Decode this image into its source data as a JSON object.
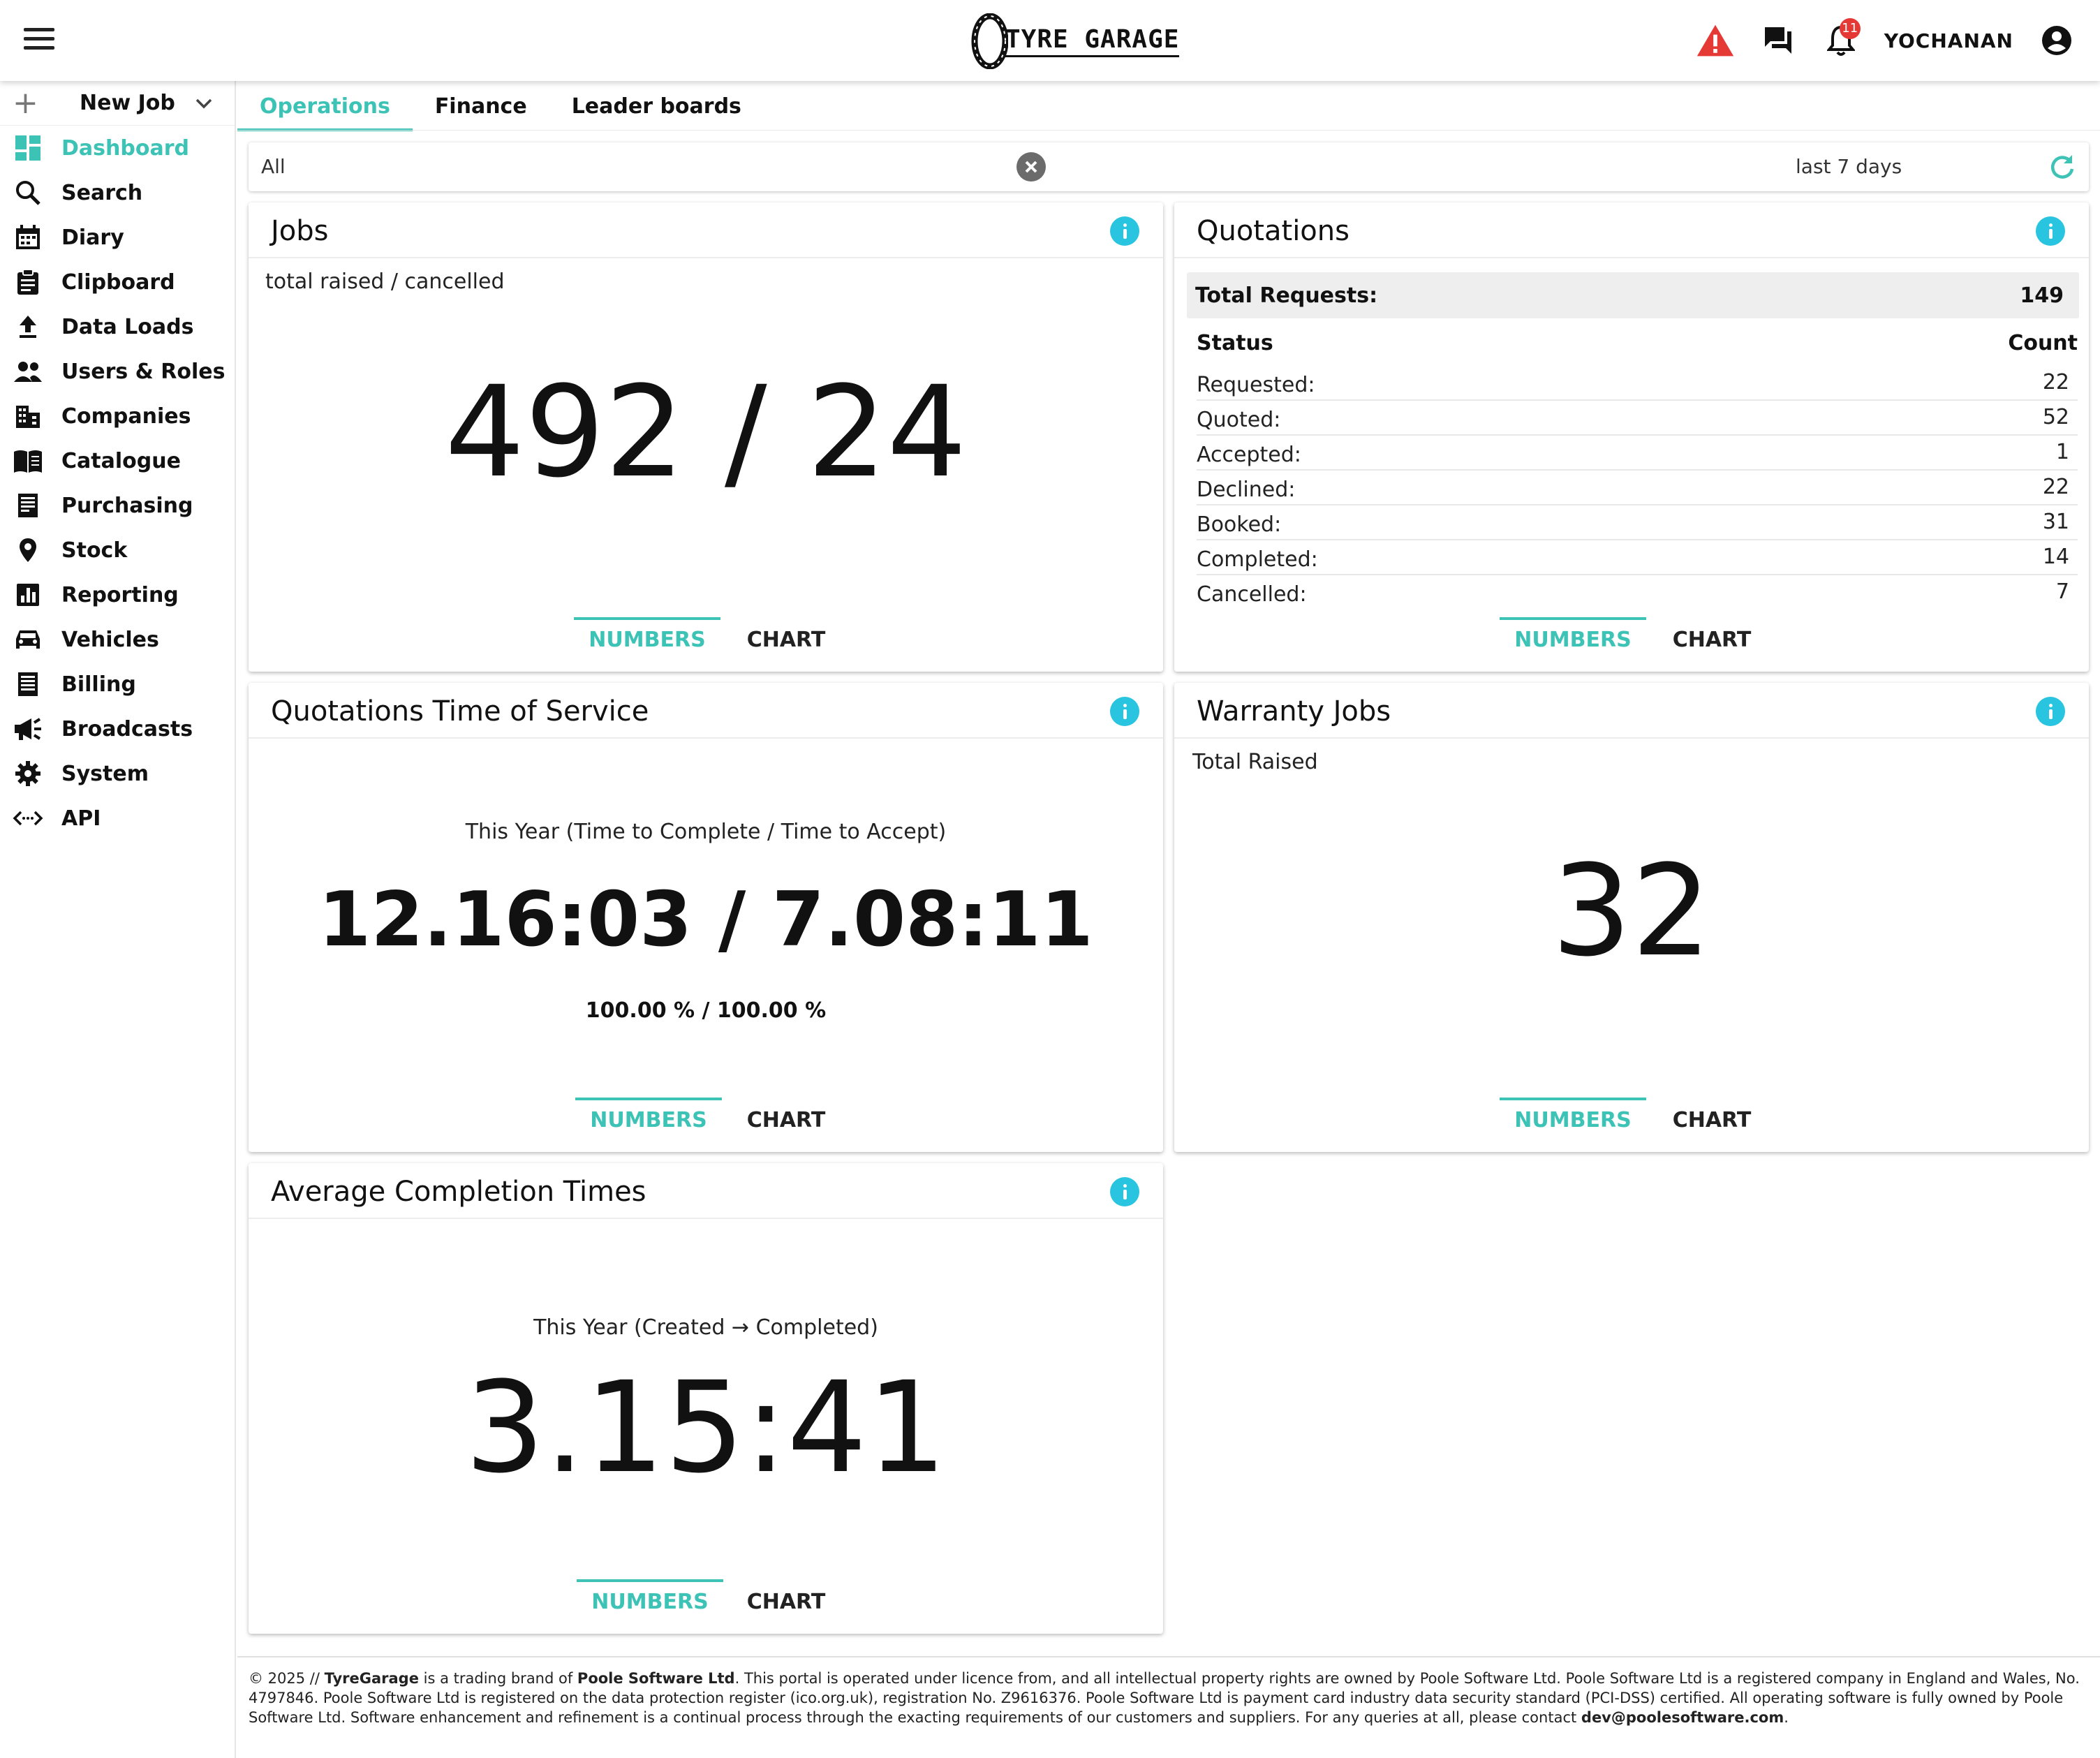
{
  "header": {
    "logo_text": "TYRE GARAGE",
    "username": "YOCHANAN",
    "notification_count": "11",
    "accent": "#3cc3b5",
    "alert_color": "#e53935"
  },
  "sidebar": {
    "new_job_label": "New Job",
    "items": [
      {
        "label": "Dashboard",
        "icon": "dashboard-icon",
        "active": true
      },
      {
        "label": "Search",
        "icon": "search-icon"
      },
      {
        "label": "Diary",
        "icon": "calendar-icon"
      },
      {
        "label": "Clipboard",
        "icon": "clipboard-icon"
      },
      {
        "label": "Data Loads",
        "icon": "upload-icon"
      },
      {
        "label": "Users & Roles",
        "icon": "people-icon"
      },
      {
        "label": "Companies",
        "icon": "building-icon"
      },
      {
        "label": "Catalogue",
        "icon": "book-icon"
      },
      {
        "label": "Purchasing",
        "icon": "receipt-icon"
      },
      {
        "label": "Stock",
        "icon": "location-pin-icon"
      },
      {
        "label": "Reporting",
        "icon": "bar-chart-icon"
      },
      {
        "label": "Vehicles",
        "icon": "car-icon"
      },
      {
        "label": "Billing",
        "icon": "invoice-icon"
      },
      {
        "label": "Broadcasts",
        "icon": "megaphone-icon"
      },
      {
        "label": "System",
        "icon": "gear-icon"
      },
      {
        "label": "API",
        "icon": "code-icon"
      }
    ]
  },
  "tabs": [
    {
      "label": "Operations",
      "active": true
    },
    {
      "label": "Finance"
    },
    {
      "label": "Leader boards"
    }
  ],
  "filter": {
    "value": "All",
    "period": "last 7 days"
  },
  "toggle": {
    "numbers": "NUMBERS",
    "chart": "CHART"
  },
  "cards": {
    "jobs": {
      "title": "Jobs",
      "subtitle": "total raised / cancelled",
      "value": "492 / 24"
    },
    "quotations": {
      "title": "Quotations",
      "total_label": "Total Requests:",
      "total_value": "149",
      "status_header": "Status",
      "count_header": "Count",
      "rows": [
        {
          "status": "Requested:",
          "count": "22"
        },
        {
          "status": "Quoted:",
          "count": "52"
        },
        {
          "status": "Accepted:",
          "count": "1"
        },
        {
          "status": "Declined:",
          "count": "22"
        },
        {
          "status": "Booked:",
          "count": "31"
        },
        {
          "status": "Completed:",
          "count": "14"
        },
        {
          "status": "Cancelled:",
          "count": "7"
        }
      ]
    },
    "qtos": {
      "title": "Quotations Time of Service",
      "subtitle": "This Year (Time to Complete / Time to Accept)",
      "value": "12.16:03 / 7.08:11",
      "percent": "100.00 % / 100.00 %"
    },
    "warranty": {
      "title": "Warranty Jobs",
      "subtitle": "Total Raised",
      "value": "32"
    },
    "avg": {
      "title": "Average Completion Times",
      "subtitle": "This Year (Created → Completed)",
      "value": "3.15:41"
    }
  },
  "footer": {
    "prefix": "© 2025 // ",
    "brand": "TyreGarage",
    "mid1": " is a trading brand of ",
    "company": "Poole Software Ltd",
    "body": ". This portal is operated under licence from, and all intellectual property rights are owned by Poole Software Ltd. Poole Software Ltd is a registered company in England and Wales, No. 4797846. Poole Software Ltd is registered on the data protection register (ico.org.uk), registration No. Z9616376. Poole Software Ltd is payment card industry data security standard (PCI-DSS) certified. All operating software is fully owned by Poole Software Ltd. Software enhancement and refinement is a continual process through the exacting requirements of our customers and suppliers. For any queries at all, please contact ",
    "email": "dev@poolesoftware.com",
    "suffix": "."
  }
}
